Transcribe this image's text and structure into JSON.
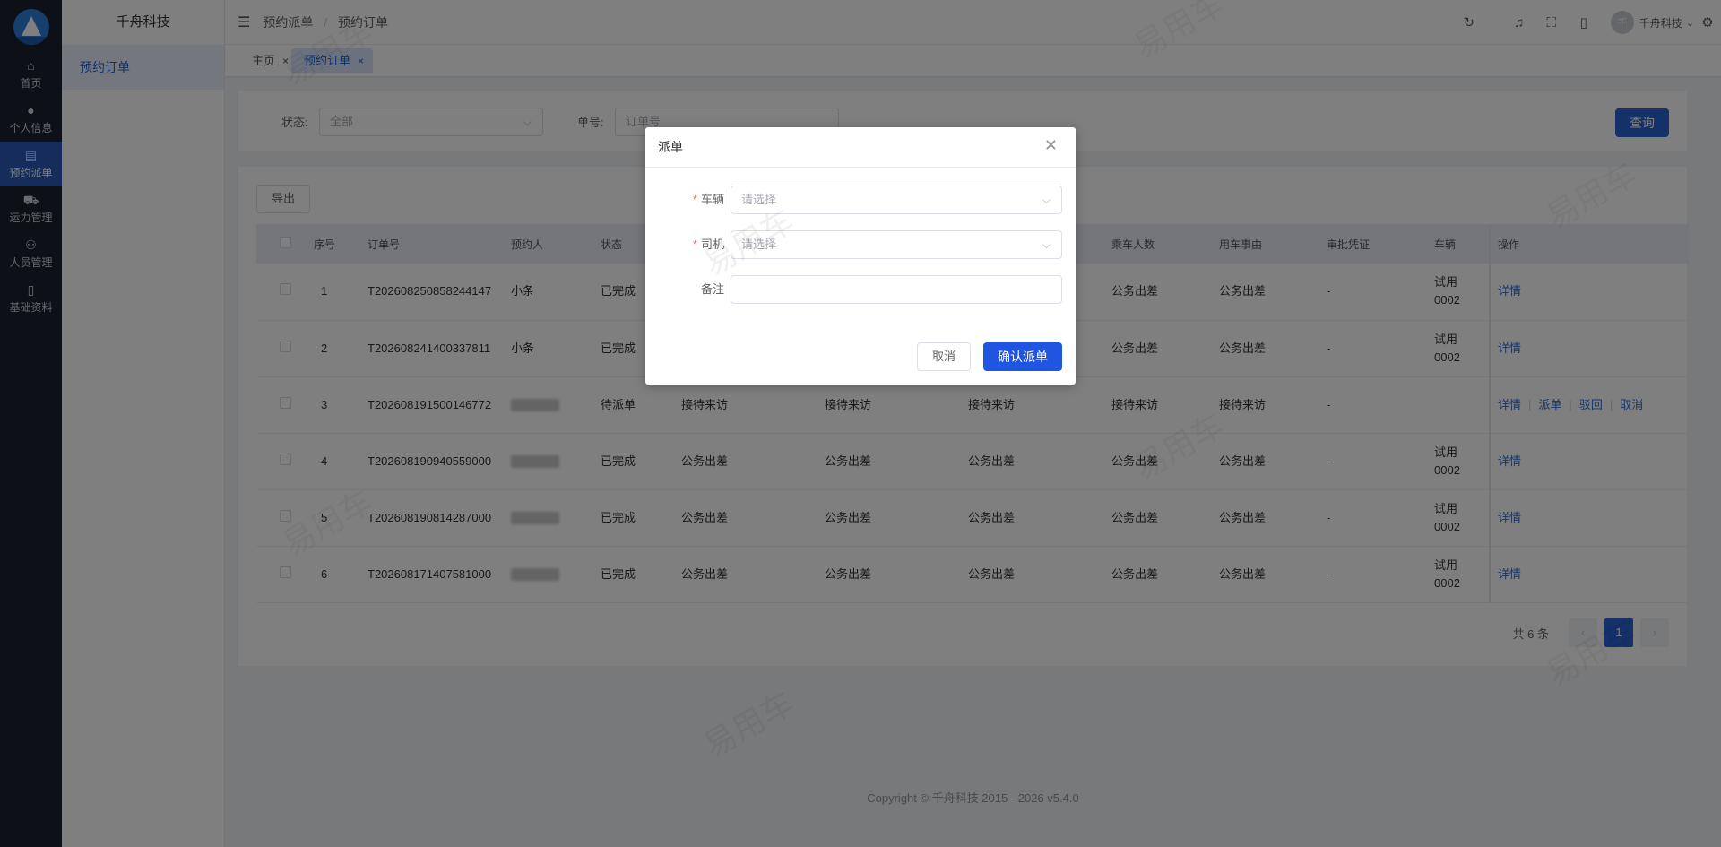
{
  "rail": {
    "items": [
      {
        "label": "首页",
        "icon": "home-icon",
        "glyph": "⌂"
      },
      {
        "label": "个人信息",
        "icon": "user-icon",
        "glyph": "●"
      },
      {
        "label": "预约派单",
        "icon": "document-icon",
        "glyph": "▤"
      },
      {
        "label": "运力管理",
        "icon": "truck-icon",
        "glyph": "⛟"
      },
      {
        "label": "人员管理",
        "icon": "person-icon",
        "glyph": "⚇"
      },
      {
        "label": "基础资料",
        "icon": "book-icon",
        "glyph": "▯"
      }
    ]
  },
  "submenu": {
    "brand": "千舟科技",
    "item": "预约订单"
  },
  "header": {
    "breadcrumb": [
      "预约派单",
      "预约订单"
    ],
    "separator": "/",
    "user_initial": "千",
    "user_name": "千舟科技"
  },
  "tags": [
    {
      "label": "主页",
      "close": "×"
    },
    {
      "label": "预约订单",
      "close": "×"
    }
  ],
  "filter": {
    "status_label": "状态:",
    "status_value": "全部",
    "order_label": "单号:",
    "order_placeholder": "订单号",
    "query_button": "查询"
  },
  "table": {
    "export_button": "导出",
    "headers": [
      "序号",
      "订单号",
      "预约人",
      "状态",
      "",
      "",
      "",
      "乘车人数",
      "用车事由",
      "审批凭证",
      "车辆",
      "操作"
    ],
    "rows": [
      {
        "no": "1",
        "order": "T202608250858244147",
        "person": "小条",
        "status": "已完成",
        "c5": "",
        "c6": "",
        "c7": "",
        "passengers": "公务出差",
        "reason": "公务出差",
        "voucher": "-",
        "vehicle": "试用0002",
        "ops": [
          "详情"
        ]
      },
      {
        "no": "2",
        "order": "T202608241400337811",
        "person": "小条",
        "status": "已完成",
        "c5": "",
        "c6": "",
        "c7": "",
        "passengers": "公务出差",
        "reason": "公务出差",
        "voucher": "-",
        "vehicle": "试用0002",
        "ops": [
          "详情"
        ]
      },
      {
        "no": "3",
        "order": "T202608191500146772",
        "person": "",
        "status": "待派单",
        "c5": "接待来访",
        "c6": "接待来访",
        "c7": "接待来访",
        "passengers": "接待来访",
        "reason": "接待来访",
        "voucher": "-",
        "vehicle": "",
        "ops": [
          "详情",
          "派单",
          "驳回",
          "取消"
        ]
      },
      {
        "no": "4",
        "order": "T202608190940559000",
        "person": "",
        "status": "已完成",
        "c5": "公务出差",
        "c6": "公务出差",
        "c7": "公务出差",
        "passengers": "公务出差",
        "reason": "公务出差",
        "voucher": "-",
        "vehicle": "试用0002",
        "ops": [
          "详情"
        ]
      },
      {
        "no": "5",
        "order": "T202608190814287000",
        "person": "",
        "status": "已完成",
        "c5": "公务出差",
        "c6": "公务出差",
        "c7": "公务出差",
        "passengers": "公务出差",
        "reason": "公务出差",
        "voucher": "-",
        "vehicle": "试用0002",
        "ops": [
          "详情"
        ]
      },
      {
        "no": "6",
        "order": "T202608171407581000",
        "person": "",
        "status": "已完成",
        "c5": "公务出差",
        "c6": "公务出差",
        "c7": "公务出差",
        "passengers": "公务出差",
        "reason": "公务出差",
        "voucher": "-",
        "vehicle": "试用0002",
        "ops": [
          "详情"
        ]
      }
    ]
  },
  "pagination": {
    "total": "共 6 条",
    "current": "1",
    "prev": "‹",
    "next": "›"
  },
  "footer": "Copyright © 千舟科技 2015 - 2026 v5.4.0",
  "dialog": {
    "title": "派单",
    "close": "✕",
    "vehicle_label": "车辆",
    "vehicle_placeholder": "请选择",
    "driver_label": "司机",
    "driver_placeholder": "请选择",
    "remark_label": "备注",
    "remark_value": "",
    "cancel_button": "取消",
    "confirm_button": "确认派单",
    "required_mark": "*"
  },
  "watermark": "易用车",
  "colors": {
    "primary": "#2b63d4",
    "rail": "#1c2031",
    "link": "#2b6bd6"
  }
}
